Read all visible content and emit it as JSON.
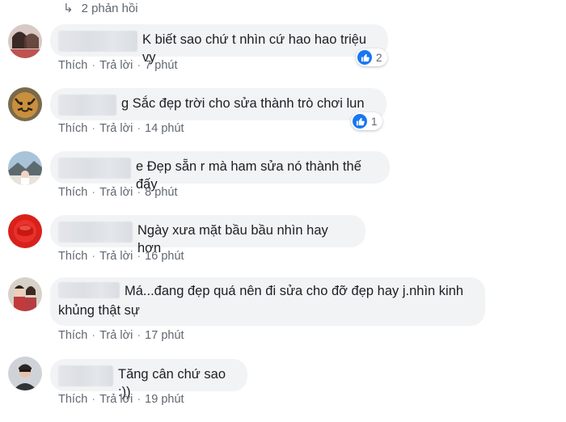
{
  "replies_link": {
    "arrow": "↳",
    "text": "2 phản hồi"
  },
  "action_labels": {
    "like": "Thích",
    "reply": "Trả lời",
    "separator": "·"
  },
  "colors": {
    "bubble": "#f2f3f5",
    "like_blue": "#1877f2",
    "meta_text": "#606770"
  },
  "comments": [
    {
      "text": "K biết sao chứ t nhìn cứ hao hao triệu vy",
      "time": "7 phút",
      "reactions": "2",
      "avatar": "user-photo-avatar"
    },
    {
      "text": "g Sắc đẹp trời cho sửa thành trò chơi lun",
      "time": "14 phút",
      "reactions": "1",
      "avatar": "tiger-photo-avatar"
    },
    {
      "text": "e Đẹp sẵn r mà ham sửa nó thành thế đấy",
      "time": "8 phút",
      "avatar": "landscape-photo-avatar"
    },
    {
      "text": "Ngày xưa mặt bầu bầu nhìn hay hơn",
      "time": "16 phút",
      "avatar": "red-icon-avatar"
    },
    {
      "text_line1": "Má...đang đẹp quá nên đi sửa cho đỡ đẹp hay j.nhìn kinh",
      "text_line2": "khủng thật sự",
      "time": "17 phút",
      "avatar": "couple-photo-avatar"
    },
    {
      "text": "Tăng cân chứ sao :))",
      "time": "19 phút",
      "avatar": "man-photo-avatar"
    }
  ]
}
